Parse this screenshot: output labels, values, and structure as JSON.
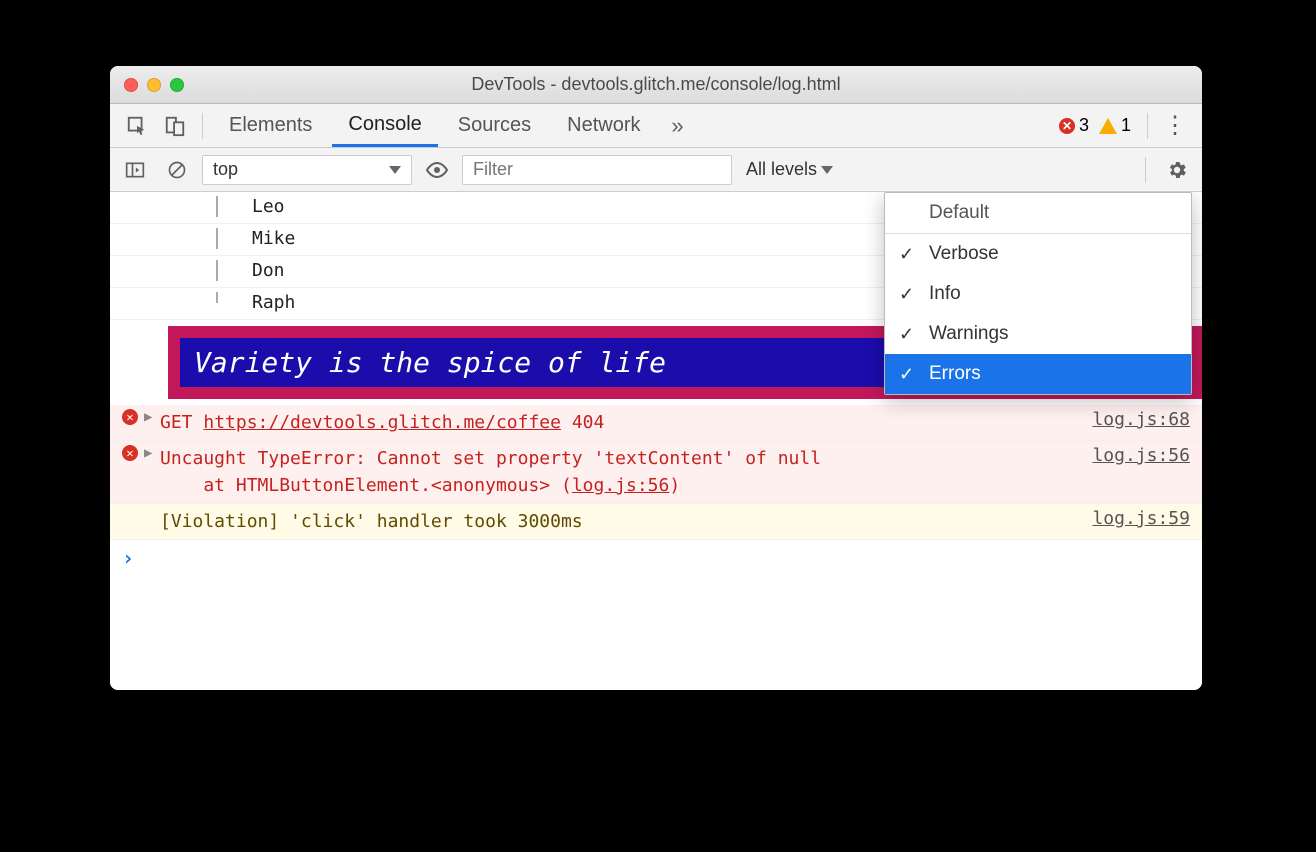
{
  "window": {
    "title": "DevTools - devtools.glitch.me/console/log.html"
  },
  "tabs": {
    "elements": "Elements",
    "console": "Console",
    "sources": "Sources",
    "network": "Network"
  },
  "badges": {
    "errors": "3",
    "warnings": "1"
  },
  "filterbar": {
    "context": "top",
    "filter_placeholder": "Filter",
    "levels_label": "All levels"
  },
  "tree": {
    "items": [
      "Leo",
      "Mike",
      "Don",
      "Raph"
    ]
  },
  "variety": "Variety is the spice of life",
  "errors": {
    "e1": {
      "method": "GET",
      "url": "https://devtools.glitch.me/coffee",
      "status": "404",
      "loc": "log.js:68"
    },
    "e2": {
      "line1": "Uncaught TypeError: Cannot set property 'textContent' of null",
      "line2a": "    at HTMLButtonElement.<anonymous> (",
      "line2link": "log.js:56",
      "line2b": ")",
      "loc": "log.js:56"
    }
  },
  "violation": {
    "text": "[Violation] 'click' handler took 3000ms",
    "loc": "log.js:59"
  },
  "levels_menu": {
    "default": "Default",
    "verbose": "Verbose",
    "info": "Info",
    "warnings": "Warnings",
    "errors": "Errors"
  }
}
